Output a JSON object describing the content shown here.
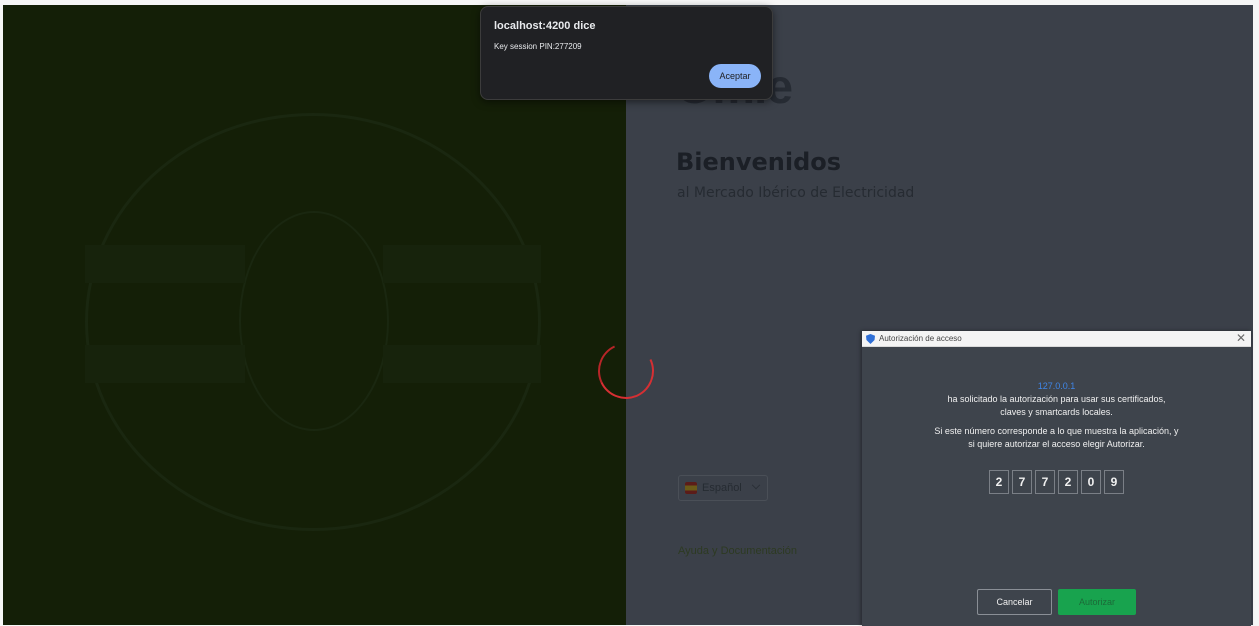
{
  "alert": {
    "title": "localhost:4200 dice",
    "message": "Key session PIN:277209",
    "ok_label": "Aceptar"
  },
  "page": {
    "logo_text": "Omie",
    "welcome_title": "Bienvenidos",
    "welcome_subtitle": "al Mercado Ibérico de Electricidad",
    "language_label": "Español",
    "help_link": "Ayuda y Documentación"
  },
  "access_dialog": {
    "title": "Autorización de acceso",
    "host": "127.0.0.1",
    "line1": "ha solicitado la autorización para usar sus certificados,",
    "line2": "claves y smartcards locales.",
    "line3": "Si este número corresponde a lo que muestra la aplicación, y",
    "line4": "si quiere autorizar el acceso elegir Autorizar.",
    "pin": [
      "2",
      "7",
      "7",
      "2",
      "0",
      "9"
    ],
    "cancel_label": "Cancelar",
    "authorize_label": "Autorizar"
  },
  "colors": {
    "accent_green": "#18a34e",
    "spinner_red": "#d62f33",
    "host_blue": "#3f86e8"
  }
}
